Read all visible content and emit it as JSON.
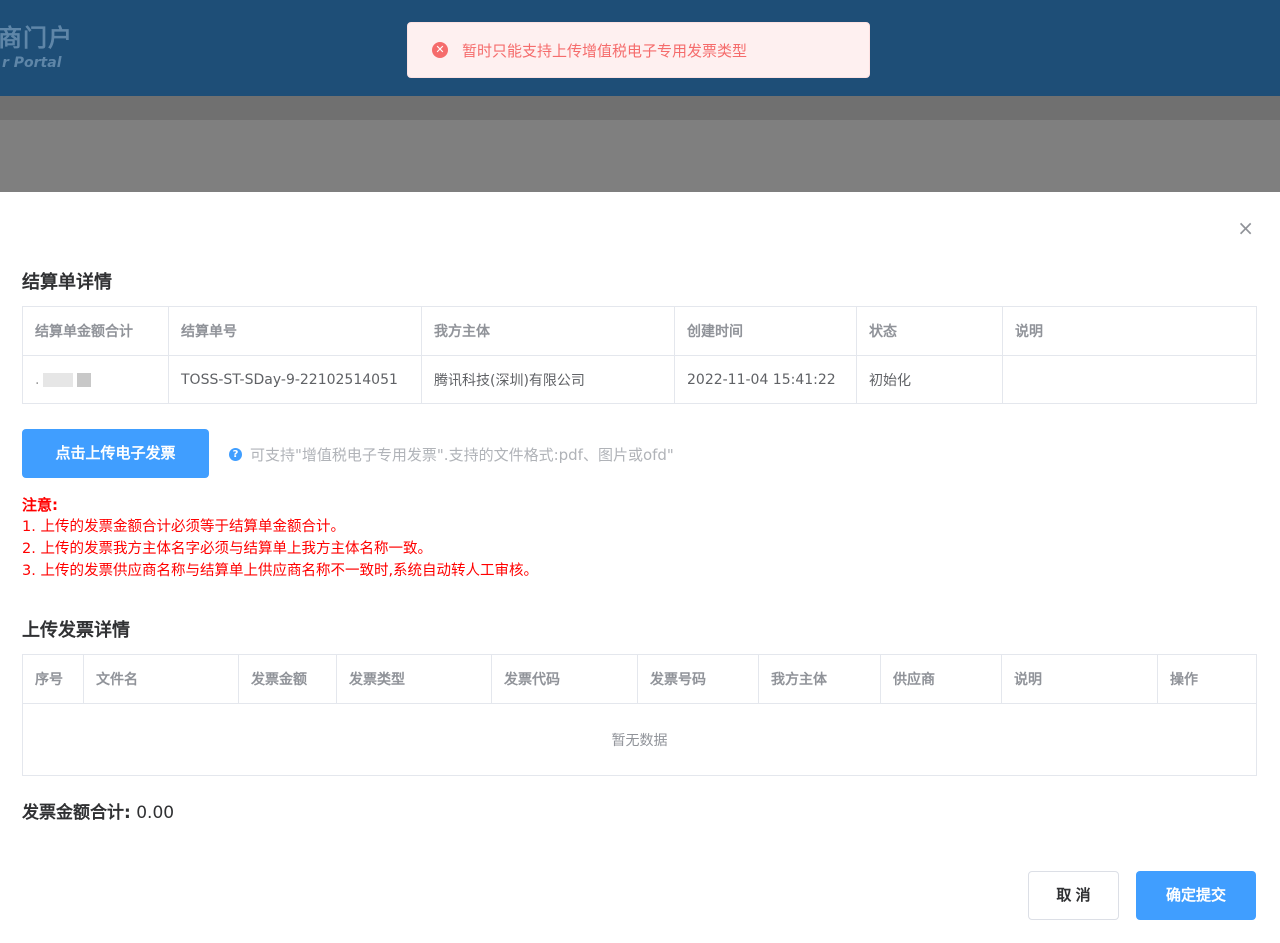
{
  "header": {
    "logo_main": "商门户",
    "logo_sub": "r Portal"
  },
  "toast": {
    "icon": "error-circle-icon",
    "message": "暂时只能支持上传增值税电子专用发票类型"
  },
  "dialog": {
    "close_label": "×",
    "settlement": {
      "title": "结算单详情",
      "columns": [
        "结算单金额合计",
        "结算单号",
        "我方主体",
        "创建时间",
        "状态",
        "说明"
      ],
      "row": {
        "amount": ".",
        "number": "TOSS-ST-SDay-9-22102514051",
        "entity": "腾讯科技(深圳)有限公司",
        "created": "2022-11-04 15:41:22",
        "status": "初始化",
        "note": ""
      }
    },
    "upload": {
      "button_label": "点击上传电子发票",
      "hint_icon": "question-circle-icon",
      "hint": "可支持\"增值税电子专用发票\".支持的文件格式:pdf、图片或ofd\""
    },
    "notes": {
      "title": "注意:",
      "items": [
        "1. 上传的发票金额合计必须等于结算单金额合计。",
        "2. 上传的发票我方主体名字必须与结算单上我方主体名称一致。",
        "3. 上传的发票供应商名称与结算单上供应商名称不一致时,系统自动转人工审核。"
      ]
    },
    "invoices": {
      "title": "上传发票详情",
      "columns": [
        "序号",
        "文件名",
        "发票金额",
        "发票类型",
        "发票代码",
        "发票号码",
        "我方主体",
        "供应商",
        "说明",
        "操作"
      ],
      "empty_text": "暂无数据"
    },
    "total": {
      "label": "发票金额合计:",
      "value": "0.00"
    },
    "footer": {
      "cancel_label": "取 消",
      "confirm_label": "确定提交"
    }
  }
}
